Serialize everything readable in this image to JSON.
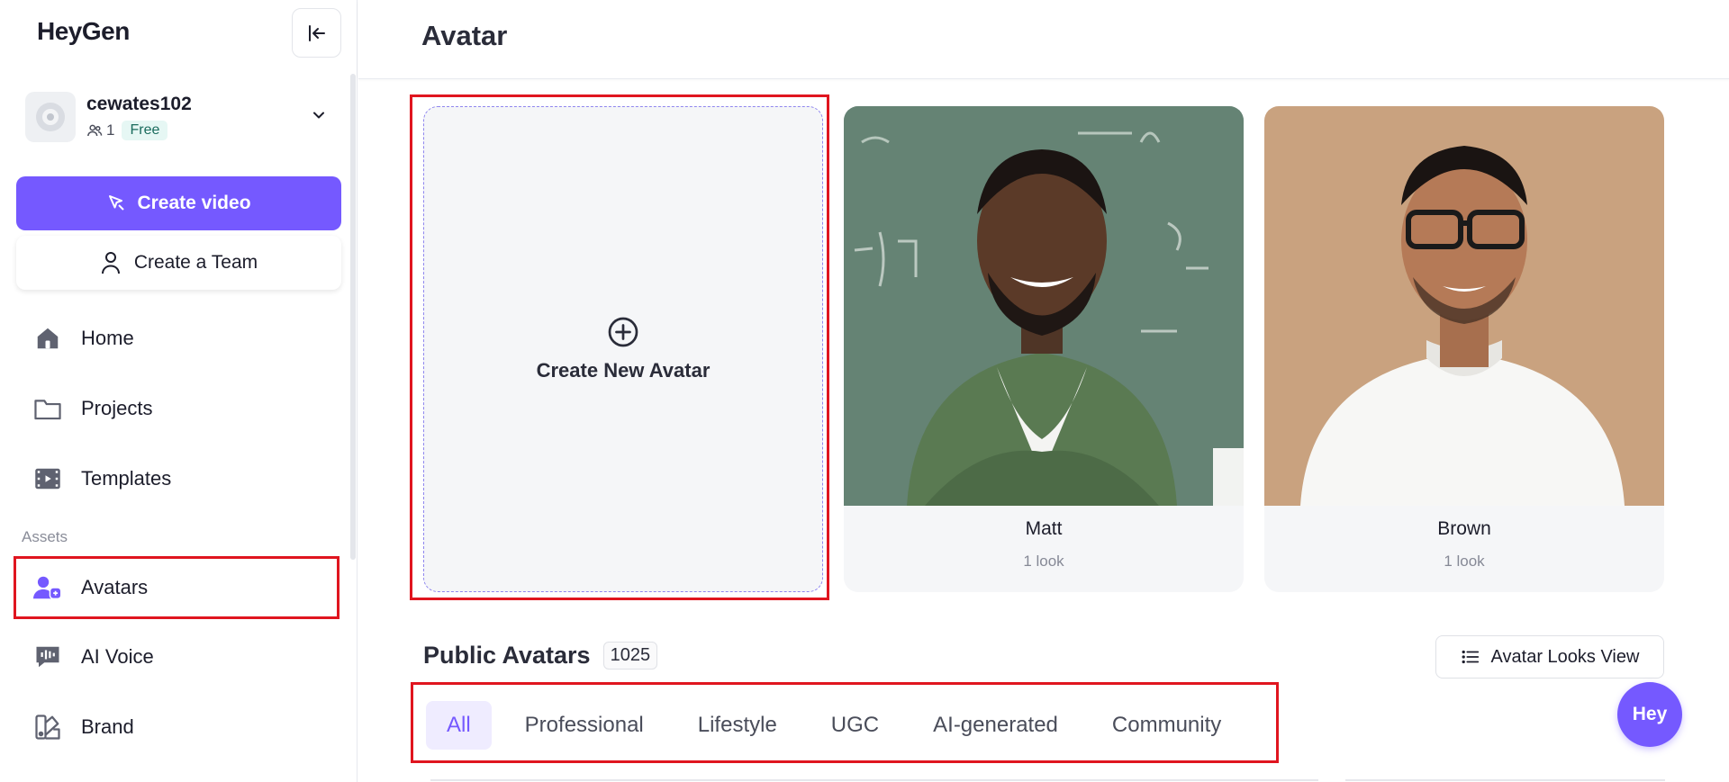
{
  "brand": {
    "logo_text": "HeyGen",
    "accent": "#7559ff",
    "highlight": "#e0151f"
  },
  "account": {
    "name": "cewates102",
    "member_count": "1",
    "plan": "Free"
  },
  "sidebar": {
    "create_video": "Create video",
    "create_team": "Create a Team",
    "assets_label": "Assets",
    "items": [
      {
        "label": "Home",
        "icon": "home-icon"
      },
      {
        "label": "Projects",
        "icon": "folder-icon"
      },
      {
        "label": "Templates",
        "icon": "film-icon"
      },
      {
        "label": "Avatars",
        "icon": "avatar-icon",
        "highlighted": true
      },
      {
        "label": "AI Voice",
        "icon": "voice-icon"
      },
      {
        "label": "Brand",
        "icon": "brand-icon"
      }
    ]
  },
  "main": {
    "title": "Avatar",
    "create_card": {
      "label": "Create New Avatar"
    },
    "avatars": [
      {
        "name": "Matt",
        "looks": "1 look"
      },
      {
        "name": "Brown",
        "looks": "1 look"
      }
    ],
    "public": {
      "title": "Public Avatars",
      "count": "1025",
      "view_button": "Avatar Looks View",
      "tabs": [
        "All",
        "Professional",
        "Lifestyle",
        "UGC",
        "AI-generated",
        "Community"
      ],
      "active_tab": "All"
    }
  },
  "fab": {
    "label": "Hey"
  }
}
